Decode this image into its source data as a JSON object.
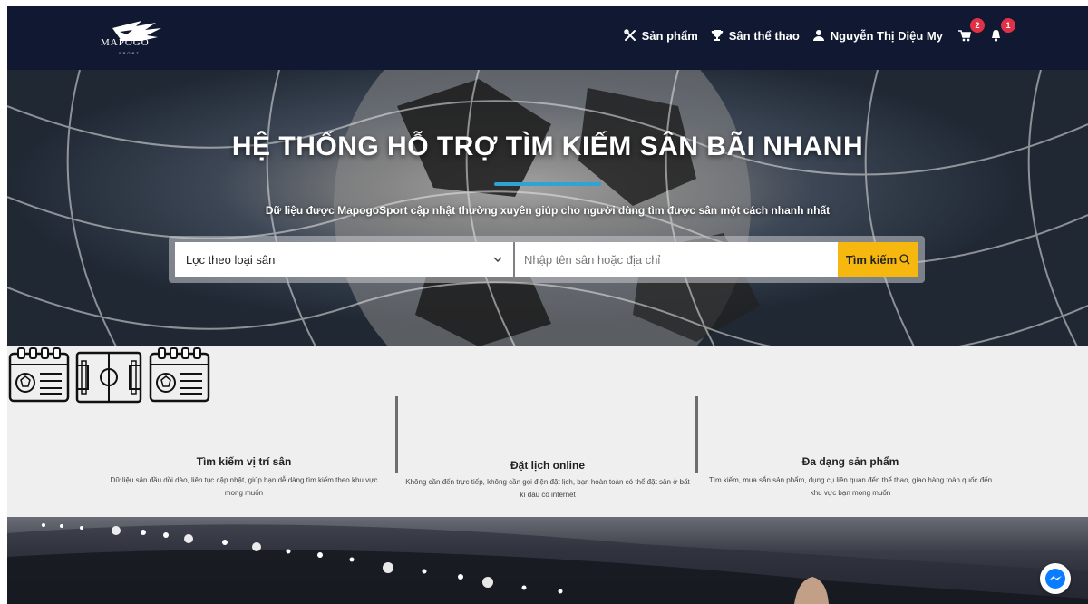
{
  "header": {
    "logo_text": "MAPOGO",
    "logo_sub": "SPORT",
    "nav": {
      "products": "Sản phẩm",
      "venues": "Sân thể thao",
      "user": "Nguyễn Thị Diệu My"
    },
    "cart_count": "2",
    "notification_count": "1"
  },
  "hero": {
    "title": "HỆ THỐNG HỖ TRỢ TÌM KIẾM SÂN BÃI NHANH",
    "subtitle": "Dữ liệu được MapogoSport cập nhật thường xuyên giúp cho người dùng tìm được sân một cách nhanh nhất",
    "underline_color": "#2ea3d6",
    "search": {
      "filter_value": "Lọc theo loại sân",
      "placeholder": "Nhập tên sân hoặc địa chỉ",
      "button_label": "Tìm kiếm",
      "button_color": "#f6b70e"
    }
  },
  "features": [
    {
      "icon": "calendar-football-icon",
      "title": "Tìm kiếm vị trí sân",
      "description": "Dữ liệu sân đầu dồi dào, liên tục cập nhật, giúp bạn dễ dàng tìm kiếm theo khu vực mong muốn"
    },
    {
      "icon": "football-field-icon",
      "title": "Đặt lịch online",
      "description": "Không cần đến trực tiếp, không cần gọi điện đặt lịch, bạn hoàn toàn có thể đặt sân ở bất kì đâu có internet"
    },
    {
      "icon": "calendar-football-icon",
      "title": "Đa dạng sản phẩm",
      "description": "Tìm kiếm, mua sắn sản phẩm, dụng cụ liên quan đến thể thao, giao hàng toàn quốc đến khu vực bạn mong muốn"
    }
  ],
  "colors": {
    "header_bg": "#111832",
    "badge": "#e03146",
    "messenger": "#0a7cff"
  }
}
